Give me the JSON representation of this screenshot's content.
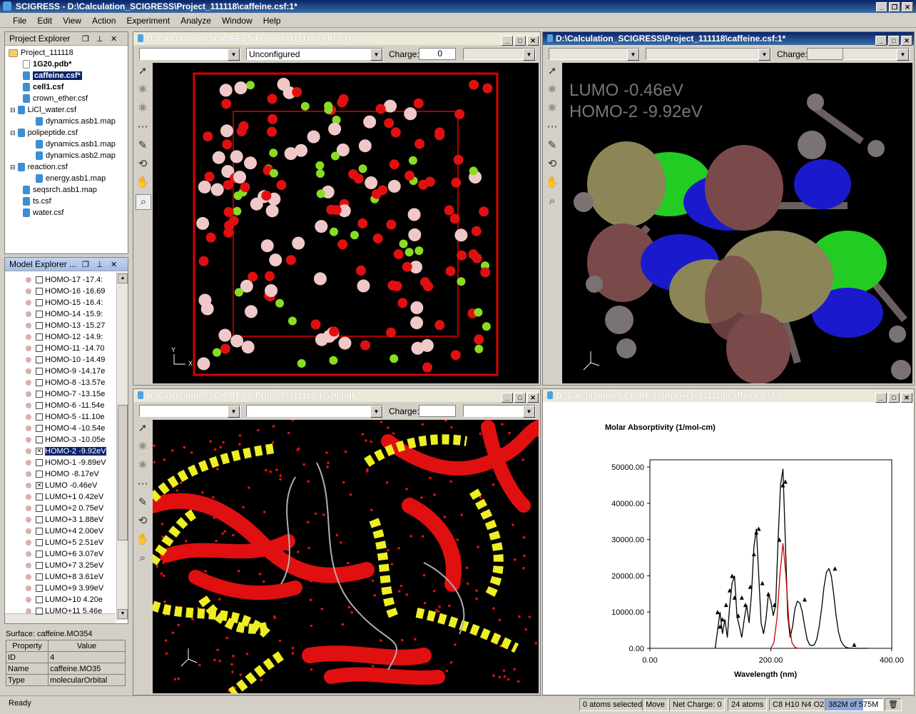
{
  "app": {
    "title": "SCIGRESS - D:\\Calculation_SCIGRESS\\Project_111118\\caffeine.csf:1*"
  },
  "menu": [
    "File",
    "Edit",
    "View",
    "Action",
    "Experiment",
    "Analyze",
    "Window",
    "Help"
  ],
  "project_explorer": {
    "title": "Project Explorer",
    "items": [
      "Project_111118",
      "1G20.pdb*",
      "caffeine.csf*",
      "cell1.csf",
      "crown_ether.csf",
      "LiCl_water.csf",
      "dynamics.asb1.map",
      "polipeptide.csf",
      "dynamics.asb1.map",
      "dynamics.asb2.map",
      "reaction.csf",
      "energy.asb1.map",
      "seqsrch.asb1.map",
      "ts.csf",
      "water.csf"
    ]
  },
  "model_explorer": {
    "title": "Model Explorer ...",
    "rows": [
      "HOMO-17 -17.4:",
      "HOMO-16 -16.69",
      "HOMO-15 -16.4:",
      "HOMO-14 -15.9:",
      "HOMO-13 -15.27",
      "HOMO-12 -14.9:",
      "HOMO-11 -14.70",
      "HOMO-10 -14.49",
      "HOMO-9 -14.17e",
      "HOMO-8 -13.57e",
      "HOMO-7 -13.15e",
      "HOMO-6 -11.54e",
      "HOMO-5 -11.10e",
      "HOMO-4 -10.54e",
      "HOMO-3 -10.05e",
      "HOMO-2 -9.92eV",
      "HOMO-1 -9.89eV",
      "HOMO -8.17eV",
      "LUMO -0.46eV",
      "LUMO+1 0.42eV",
      "LUMO+2 0.75eV",
      "LUMO+3 1.88eV",
      "LUMO+4 2.00eV",
      "LUMO+5 2.51eV",
      "LUMO+6 3.07eV",
      "LUMO+7 3.25eV",
      "LUMO+8 3.61eV",
      "LUMO+9 3.99eV",
      "LUMO+10 4.20e",
      "LUMO+11 5.46e"
    ],
    "surface_label": "Surface: caffeine.MO354"
  },
  "properties": {
    "headers": [
      "Property",
      "Value"
    ],
    "rows": [
      [
        "ID",
        "4"
      ],
      [
        "Name",
        "caffeine.MO35"
      ],
      [
        "Type",
        "molecularOrbital"
      ]
    ]
  },
  "windows": {
    "cell1": {
      "title": "D:\\Calculation_SCIGRESS\\Project_111118\\cell1.csf*",
      "combo": "Unconfigured",
      "charge_label": "Charge:",
      "charge": "0"
    },
    "caffeine1": {
      "title": "D:\\Calculation_SCIGRESS\\Project_111118\\caffeine.csf:1*",
      "charge_label": "Charge:",
      "lumo": "LUMO  -0.46eV",
      "homo": "HOMO-2  -9.92eV"
    },
    "pdb": {
      "title": "D:\\Calculation_SCIGRESS\\Project_111118\\1G20.pdb*",
      "charge_label": "Charge:"
    },
    "caffeine2": {
      "title": "D:\\Calculation_SCIGRESS\\Project_111118\\caffeine.csf:2*"
    }
  },
  "chart_data": {
    "type": "line",
    "title": "Molar Absorptivity (1/mol-cm)",
    "xlabel": "Wavelength (nm)",
    "ylabel": "",
    "xlim": [
      0,
      400
    ],
    "ylim": [
      0,
      52000
    ],
    "xticks": [
      "0.00",
      "200.00",
      "400.00"
    ],
    "yticks": [
      "0.00",
      "10000.00",
      "20000.00",
      "30000.00",
      "40000.00",
      "50000.00"
    ],
    "series": [
      {
        "color": "#000000",
        "x": [
          108,
          112,
          116,
          120,
          124,
          128,
          132,
          136,
          140,
          144,
          148,
          152,
          156,
          160,
          164,
          168,
          172,
          176,
          180,
          184,
          188,
          192,
          196,
          200,
          204,
          208,
          212,
          216,
          220,
          224,
          228,
          232,
          236,
          240,
          244,
          248,
          252,
          256,
          260,
          264,
          268,
          272,
          276,
          280,
          284,
          288,
          292,
          296,
          300,
          304,
          308,
          312,
          316,
          320,
          324,
          328,
          332,
          336,
          340,
          344,
          350,
          360
        ],
        "y": [
          0,
          5000,
          10000,
          4000,
          8000,
          3000,
          12000,
          18000,
          20000,
          9000,
          6000,
          3000,
          8000,
          12000,
          7000,
          15000,
          28000,
          33000,
          20000,
          7000,
          4000,
          8000,
          15000,
          13000,
          9000,
          12000,
          30000,
          45000,
          49500,
          30000,
          9000,
          3000,
          6000,
          11000,
          13000,
          12500,
          10000,
          6000,
          2500,
          1000,
          700,
          1000,
          2500,
          6000,
          11000,
          17000,
          21000,
          22000,
          20000,
          15000,
          9000,
          4500,
          2000,
          900,
          300,
          100,
          50,
          0,
          0,
          0,
          0,
          0
        ]
      },
      {
        "color": "#cc0000",
        "x": [
          200,
          205,
          210,
          215,
          220,
          225,
          230,
          235,
          240,
          245,
          250
        ],
        "y": [
          0,
          1500,
          8000,
          20000,
          29000,
          20000,
          7000,
          1500,
          300,
          0,
          0
        ]
      }
    ],
    "markers": [
      [
        112,
        10000
      ],
      [
        116,
        6000
      ],
      [
        120,
        8000
      ],
      [
        126,
        12000
      ],
      [
        132,
        16000
      ],
      [
        136,
        20000
      ],
      [
        140,
        14000
      ],
      [
        146,
        9000
      ],
      [
        152,
        14000
      ],
      [
        158,
        12000
      ],
      [
        166,
        17000
      ],
      [
        172,
        26000
      ],
      [
        176,
        32000
      ],
      [
        180,
        33000
      ],
      [
        186,
        18000
      ],
      [
        196,
        15000
      ],
      [
        206,
        12000
      ],
      [
        214,
        30000
      ],
      [
        220,
        45000
      ],
      [
        224,
        46000
      ],
      [
        256,
        13500
      ],
      [
        306,
        22000
      ],
      [
        338,
        1000
      ]
    ]
  },
  "status": {
    "ready": "Ready",
    "atoms_selected": "0 atoms selected",
    "mode": "Move",
    "net_charge": "Net Charge: 0",
    "atoms": "24 atoms",
    "formula": "C8 H10 N4 O2",
    "memory": "382M of 575M",
    "memory_fraction": 0.664
  }
}
